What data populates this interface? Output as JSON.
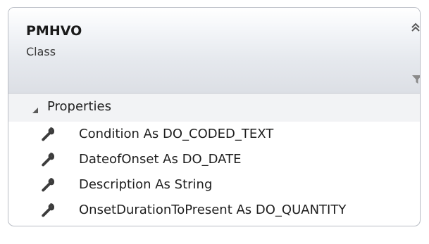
{
  "class_shape": {
    "name": "PMHVO",
    "kind": "Class"
  },
  "sections": {
    "properties": {
      "title": "Properties",
      "items": [
        {
          "label": "Condition As DO_CODED_TEXT",
          "icon": "wrench-icon"
        },
        {
          "label": "DateofOnset As DO_DATE",
          "icon": "wrench-icon"
        },
        {
          "label": "Description As String",
          "icon": "wrench-icon"
        },
        {
          "label": "OnsetDurationToPresent As DO_QUANTITY",
          "icon": "wrench-icon"
        }
      ]
    }
  },
  "icons": {
    "collapse": "double-chevron-up-icon",
    "filter": "filter-funnel-icon",
    "section_toggle": "triangle-expanded-icon"
  },
  "colors": {
    "border": "#b8bcc4",
    "header_top": "#ffffff",
    "header_bottom": "#dcdfe5",
    "text": "#1e1e1e",
    "icon": "#3c3c3c"
  }
}
